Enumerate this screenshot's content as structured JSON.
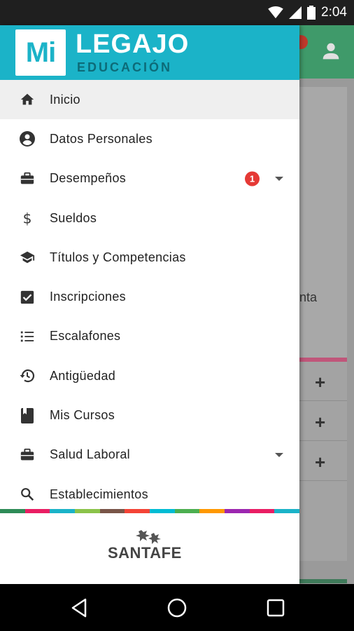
{
  "status": {
    "time": "2:04"
  },
  "background": {
    "partial_text": "nta",
    "plus_signs": [
      "+",
      "+",
      "+"
    ]
  },
  "drawer": {
    "logo_mark": "Mi",
    "title": "LEGAJO",
    "subtitle": "EDUCACIÓN",
    "items": [
      {
        "label": "Inicio",
        "icon": "home-icon",
        "active": true
      },
      {
        "label": "Datos Personales",
        "icon": "account-circle-icon"
      },
      {
        "label": "Desempeños",
        "icon": "briefcase-icon",
        "badge": "1",
        "expandable": true
      },
      {
        "label": "Sueldos",
        "icon": "dollar-icon"
      },
      {
        "label": "Títulos y Competencias",
        "icon": "school-icon"
      },
      {
        "label": "Inscripciones",
        "icon": "checkbox-icon"
      },
      {
        "label": "Escalafones",
        "icon": "list-icon"
      },
      {
        "label": "Antigüedad",
        "icon": "history-icon"
      },
      {
        "label": "Mis Cursos",
        "icon": "book-icon"
      },
      {
        "label": "Salud Laboral",
        "icon": "briefcase-icon",
        "expandable": true
      },
      {
        "label": "Establecimientos",
        "icon": "search-icon"
      }
    ],
    "footer_logo": "SANTAFE",
    "strip_colors": [
      "#2e8b57",
      "#e91e63",
      "#1bb3c8",
      "#8bc34a",
      "#795548",
      "#f44336",
      "#00bcd4",
      "#4caf50",
      "#ff9800",
      "#9c27b0",
      "#e91e63",
      "#1bb3c8"
    ]
  },
  "colors": {
    "header": "#1bb3c8",
    "badge": "#e53935"
  }
}
